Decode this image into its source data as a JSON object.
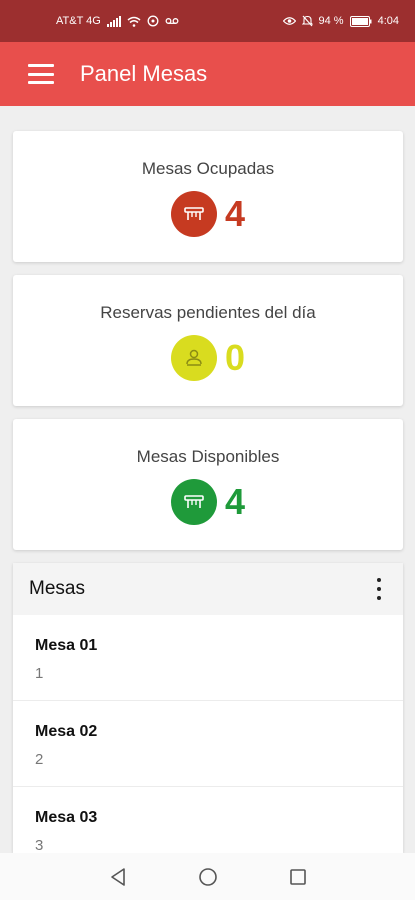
{
  "status_bar": {
    "carrier": "AT&T 4G",
    "battery": "94 %",
    "time": "4:04"
  },
  "app_bar": {
    "title": "Panel Mesas"
  },
  "cards": [
    {
      "title": "Mesas Ocupadas",
      "value": "4",
      "color": "#c63a21",
      "icon": "table-icon"
    },
    {
      "title": "Reservas pendientes del día",
      "value": "0",
      "color": "#d9dc1f",
      "icon": "user-icon"
    },
    {
      "title": "Mesas Disponibles",
      "value": "4",
      "color": "#1f9a3a",
      "icon": "table-icon"
    }
  ],
  "mesas": {
    "title": "Mesas",
    "items": [
      {
        "name": "Mesa 01",
        "number": "1"
      },
      {
        "name": "Mesa 02",
        "number": "2"
      },
      {
        "name": "Mesa 03",
        "number": "3"
      }
    ]
  }
}
